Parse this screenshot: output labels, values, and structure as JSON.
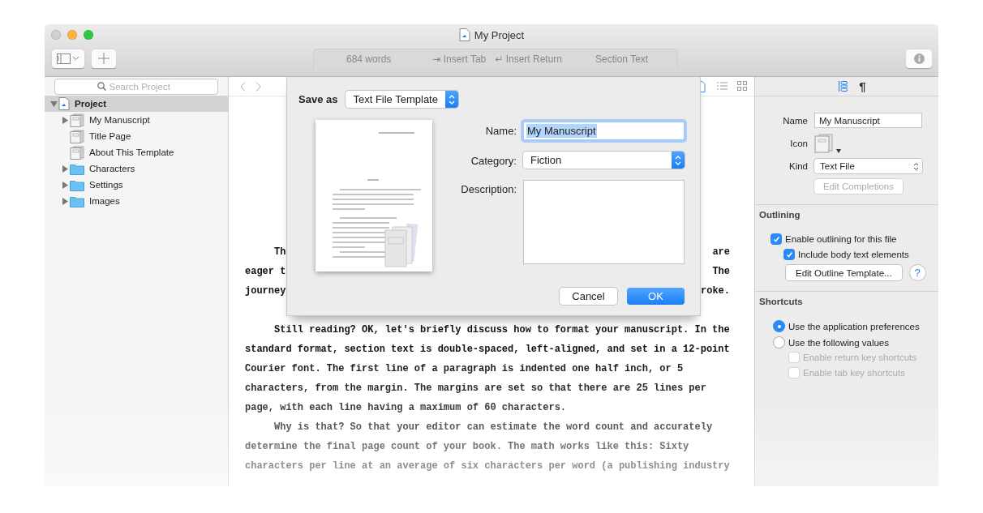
{
  "window": {
    "title": "My Project"
  },
  "toolbar": {
    "word_count": "684 words",
    "actions": [
      "⇥ Insert Tab",
      "↵ Insert Return"
    ],
    "section": "Section Text"
  },
  "sidebar": {
    "search": {
      "placeholder": "Search Project"
    },
    "tree": [
      {
        "label": "Project",
        "kind": "project",
        "expanded": true,
        "selected": true,
        "children": [
          {
            "label": "My Manuscript",
            "kind": "document",
            "expanded": false,
            "selected": false
          },
          {
            "label": "Title Page",
            "kind": "document",
            "selected": false
          },
          {
            "label": "About This Template",
            "kind": "document",
            "selected": false
          },
          {
            "label": "Characters",
            "kind": "folder",
            "expanded": false,
            "selected": false
          },
          {
            "label": "Settings",
            "kind": "folder",
            "expanded": false,
            "selected": false
          },
          {
            "label": "Images",
            "kind": "folder",
            "expanded": false,
            "selected": false
          }
        ]
      }
    ]
  },
  "editor": {
    "view_modes": [
      {
        "kind": "document",
        "selected": true
      },
      {
        "kind": "outline",
        "selected": false
      },
      {
        "kind": "corkboard",
        "selected": false
      }
    ],
    "lines": [
      {
        "kind": "split",
        "indent": true,
        "left": "Th",
        "right": "are"
      },
      {
        "kind": "split",
        "indent": false,
        "left": "eager t",
        "right": "The"
      },
      {
        "kind": "split",
        "indent": false,
        "left": "journey",
        "right": "roke."
      },
      {
        "kind": "blank"
      },
      {
        "kind": "full",
        "indent": true,
        "text": "Still reading? OK, let's briefly discuss how to format your manuscript. In the"
      },
      {
        "kind": "full",
        "indent": false,
        "text": "standard format, section text is double-spaced, left-aligned, and set in a 12-point"
      },
      {
        "kind": "full",
        "indent": false,
        "text": "Courier font. The first line of a paragraph is indented one half inch, or 5"
      },
      {
        "kind": "full",
        "indent": false,
        "text": "characters, from the margin. The margins are set so that there are 25 lines per"
      },
      {
        "kind": "full",
        "indent": false,
        "text": "page, with each line having a maximum of 60 characters."
      },
      {
        "kind": "full",
        "indent": true,
        "text": "Why is that? So that your editor can estimate the word count and accurately"
      },
      {
        "kind": "full",
        "indent": false,
        "text": "determine the final page count of your book. The math works like this: Sixty"
      },
      {
        "kind": "full",
        "indent": false,
        "text": "characters per line at an average of six characters per word (a publishing industry"
      }
    ]
  },
  "dialog": {
    "save_as": {
      "label": "Save as",
      "value": "Text File Template"
    },
    "name": {
      "label": "Name:",
      "value": "My Manuscript",
      "value_selected": true
    },
    "category": {
      "label": "Category:",
      "value": "Fiction"
    },
    "description": {
      "label": "Description:"
    },
    "buttons": [
      {
        "label": "Cancel",
        "kind": "normal"
      },
      {
        "label": "OK",
        "kind": "default"
      }
    ]
  },
  "inspector": {
    "tabs": [
      {
        "kind": "icon",
        "selected": true
      },
      {
        "kind": "glyph",
        "label": "¶",
        "selected": false
      }
    ],
    "name": {
      "label": "Name",
      "value": "My Manuscript"
    },
    "icon": {
      "label": "Icon"
    },
    "kind": {
      "label": "Kind",
      "value": "Text File"
    },
    "completions_button": {
      "label": "Edit Completions",
      "disabled": true
    },
    "outlining": {
      "title": "Outlining",
      "options": [
        {
          "label": "Enable outlining for this file",
          "checked": true,
          "children": [
            {
              "label": "Include body text elements",
              "checked": true
            }
          ]
        }
      ],
      "template_button": "Edit Outline Template...",
      "help": "?"
    },
    "shortcuts": {
      "title": "Shortcuts",
      "choices": [
        {
          "label": "Use the application preferences",
          "selected": true
        },
        {
          "label": "Use the following values",
          "selected": false
        }
      ],
      "options": [
        {
          "label": "Enable return key shortcuts",
          "checked": false,
          "disabled": true
        },
        {
          "label": "Enable tab key shortcuts",
          "checked": false,
          "disabled": true
        }
      ]
    }
  }
}
